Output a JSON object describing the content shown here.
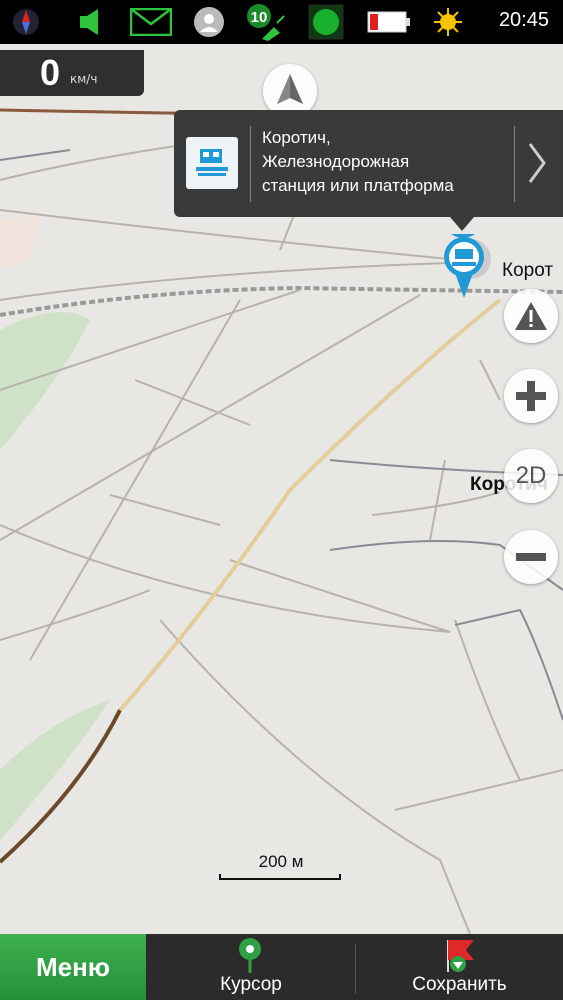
{
  "status_bar": {
    "time": "20:45",
    "satellite_count": "10",
    "icons": [
      "compass-icon",
      "sound-icon",
      "message-icon",
      "contact-icon",
      "satellite-icon",
      "gps-status-icon",
      "battery-icon",
      "weather-sun-icon"
    ],
    "battery_color": "#e02020",
    "gps_color": "#19b02e"
  },
  "speed": {
    "value": "0",
    "unit": "км/ч"
  },
  "popup": {
    "line1": "Коротич,",
    "line2": "Железнодорожная",
    "line3": "станция или платформа"
  },
  "map": {
    "poi_label": "Корот",
    "city_label": "Коротич",
    "scale_label": "200 м",
    "zoom_mode_label": "2D",
    "poi_color": "#1f9ad6"
  },
  "bottom_bar": {
    "menu_label": "Меню",
    "cursor_label": "Курсор",
    "save_label": "Сохранить",
    "menu_color": "#2fa043"
  }
}
